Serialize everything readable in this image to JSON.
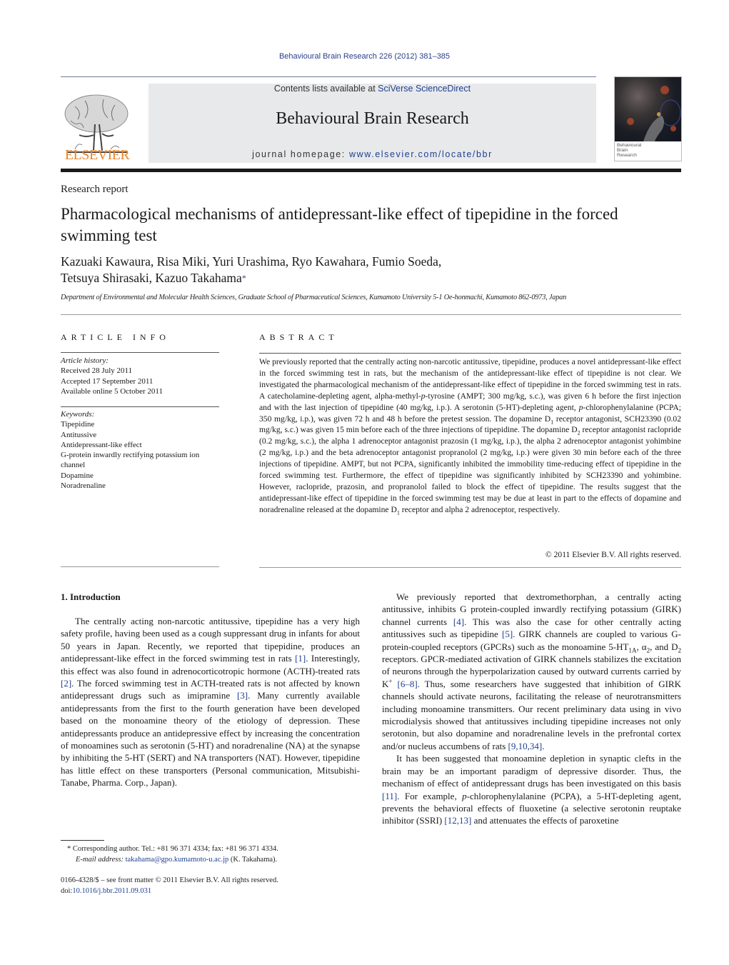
{
  "header": {
    "journal_ref": "Behavioural Brain Research 226 (2012) 381–385",
    "contents_prefix": "Contents lists available at ",
    "contents_link": "SciVerse ScienceDirect",
    "journal_title": "Behavioural Brain Research",
    "homepage_prefix": "journal homepage: ",
    "homepage_link": "www.elsevier.com/locate/bbr",
    "publisher_logo_text": "ELSEVIER",
    "cover_text": [
      "Behavioural",
      "Brain",
      "Research"
    ]
  },
  "article": {
    "type": "Research report",
    "title": "Pharmacological mechanisms of antidepressant-like effect of tipepidine in the forced swimming test",
    "authors_line1": "Kazuaki Kawaura, Risa Miki, Yuri Urashima, Ryo Kawahara, Fumio Soeda,",
    "authors_line2": "Tetsuya Shirasaki, Kazuo Takahama",
    "corresponding_mark": "*",
    "affiliation": "Department of Environmental and Molecular Health Sciences, Graduate School of Pharmaceutical Sciences, Kumamoto University 5-1 Oe-honmachi, Kumamoto 862-0973, Japan"
  },
  "article_info": {
    "heading": "ARTICLE INFO",
    "history_label": "Article history:",
    "history": [
      "Received 28 July 2011",
      "Accepted 17 September 2011",
      "Available online 5 October 2011"
    ],
    "keywords_label": "Keywords:",
    "keywords": [
      "Tipepidine",
      "Antitussive",
      "Antidepressant-like effect",
      "G-protein inwardly rectifying potassium ion channel",
      "Dopamine",
      "Noradrenaline"
    ]
  },
  "abstract": {
    "heading": "ABSTRACT",
    "text_1": "We previously reported that the centrally acting non-narcotic antitussive, tipepidine, produces a novel antidepressant-like effect in the forced swimming test in rats, but the mechanism of the antidepressant-like effect of tipepidine is not clear. We investigated the pharmacological mechanism of the antidepressant-like effect of tipepidine in the forced swimming test in rats. A catecholamine-depleting agent, alpha-methyl-",
    "italic_p1": "p",
    "text_2": "-tyrosine (AMPT; 300 mg/kg, s.c.), was given 6 h before the first injection and with the last injection of tipepidine (40 mg/kg, i.p.). A serotonin (5-HT)-depleting agent, ",
    "italic_p2": "p",
    "text_3": "-chlorophenylalanine (PCPA; 350 mg/kg, i.p.), was given 72 h and 48 h before the pretest session. The dopamine D",
    "sub_1": "1",
    "text_4": " receptor antagonist, SCH23390 (0.02 mg/kg, s.c.) was given 15 min before each of the three injections of tipepidine. The dopamine D",
    "sub_2": "2",
    "text_5": " receptor antagonist raclopride (0.2 mg/kg, s.c.), the alpha 1 adrenoceptor antagonist prazosin (1 mg/kg, i.p.), the alpha 2 adrenoceptor antagonist yohimbine (2 mg/kg, i.p.) and the beta adrenoceptor antagonist propranolol (2 mg/kg, i.p.) were given 30 min before each of the three injections of tipepidine. AMPT, but not PCPA, significantly inhibited the immobility time-reducing effect of tipepidine in the forced swimming test. Furthermore, the effect of tipepidine was significantly inhibited by SCH23390 and yohimbine. However, raclopride, prazosin, and propranolol failed to block the effect of tipepidine. The results suggest that the antidepressant-like effect of tipepidine in the forced swimming test may be due at least in part to the effects of dopamine and noradrenaline released at the dopamine D",
    "sub_3": "1",
    "text_6": " receptor and alpha 2 adrenoceptor, respectively.",
    "copyright": "© 2011 Elsevier B.V. All rights reserved."
  },
  "introduction": {
    "heading": "1.  Introduction",
    "left_p1_a": "The centrally acting non-narcotic antitussive, tipepidine has a very high safety profile, having been used as a cough suppressant drug in infants for about 50 years in Japan. Recently, we reported that tipepidine, produces an antidepressant-like effect in the forced swimming test in rats ",
    "ref_1": "[1]",
    "left_p1_b": ". Interestingly, this effect was also found in adrenocorticotropic hormone (ACTH)-treated rats ",
    "ref_2": "[2]",
    "left_p1_c": ". The forced swimming test in ACTH-treated rats is not affected by known antidepressant drugs such as imipramine ",
    "ref_3": "[3]",
    "left_p1_d": ". Many currently available antidepressants from the first to the fourth generation have been developed based on the monoamine theory of the etiology of depression. These antidepressants produce an antidepressive effect by increasing the concentration of monoamines such as serotonin (5-HT) and noradrenaline (NA) at the synapse by inhibiting the 5-HT (SERT) and NA transporters (NAT). However, tipepidine has little effect on these transporters (Personal communication, Mitsubishi-Tanabe, Pharma. Corp., Japan).",
    "right_p1_a": "We previously reported that dextromethorphan, a centrally acting antitussive, inhibits G protein-coupled inwardly rectifying potassium (GIRK) channel currents ",
    "ref_4": "[4]",
    "right_p1_b": ". This was also the case for other centrally acting antitussives such as tipepidine ",
    "ref_5": "[5]",
    "right_p1_c": ". GIRK channels are coupled to various G-protein-coupled receptors (GPCRs) such as the monoamine 5-HT",
    "sub_1a": "1A",
    "right_p1_d": ", α",
    "sub_alpha": "2",
    "right_p1_e": ", and D",
    "sub_d2": "2",
    "right_p1_f": " receptors. GPCR-mediated activation of GIRK channels stabilizes the excitation of neurons through the hyperpolarization caused by outward currents carried by K",
    "sup_plus": "+",
    "ref_6_8": "[6–8]",
    "right_p1_g": ". Thus, some researchers have suggested that inhibition of GIRK channels should activate neurons, facilitating the release of neurotransmitters including monoamine transmitters. Our recent preliminary data using in vivo microdialysis showed that antitussives including tipepidine increases not only serotonin, but also dopamine and noradrenaline levels in the prefrontal cortex and/or nucleus accumbens of rats ",
    "ref_9_10_34": "[9,10,34]",
    "right_p1_h": ".",
    "right_p2_a": "It has been suggested that monoamine depletion in synaptic clefts in the brain may be an important paradigm of depressive disorder. Thus, the mechanism of effect of antidepressant drugs has been investigated on this basis ",
    "ref_11": "[11]",
    "right_p2_b": ". For example, ",
    "italic_p": "p",
    "right_p2_c": "-chlorophenylalanine (PCPA), a 5-HT-depleting agent, prevents the behavioral effects of fluoxetine (a selective serotonin reuptake inhibitor (SSRI) ",
    "ref_12_13": "[12,13]",
    "right_p2_d": " and attenuates the effects of paroxetine"
  },
  "footnotes": {
    "star_line": "* Corresponding author. Tel.: +81 96 371 4334; fax: +81 96 371 4334.",
    "email_label": "E-mail address: ",
    "email": "takahama@gpo.kumamoto-u.ac.jp",
    "email_suffix": " (K. Takahama).",
    "front_matter": "0166-4328/$ – see front matter © 2011 Elsevier B.V. All rights reserved.",
    "doi_prefix": "doi:",
    "doi": "10.1016/j.bbr.2011.09.031"
  },
  "colors": {
    "link": "#1f3f8f",
    "elsevier_orange": "#e8872a",
    "header_box": "#e8e9eb"
  }
}
